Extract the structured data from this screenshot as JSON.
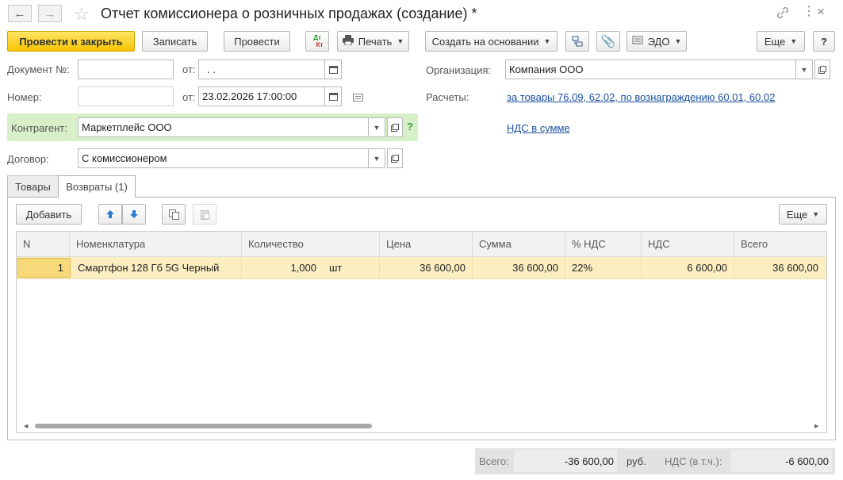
{
  "window": {
    "title": "Отчет комиссионера о розничных продажах (создание) *",
    "nav_back": "←",
    "nav_forward": "→"
  },
  "toolbar": {
    "post_close": "Провести и закрыть",
    "save": "Записать",
    "post": "Провести",
    "dtkt_top": "Дт",
    "dtkt_bottom": "Кт",
    "print": "Печать",
    "create_based": "Создать на основании",
    "edo": "ЭДО",
    "more": "Еще",
    "help": "?"
  },
  "form": {
    "doc_number_label": "Документ №:",
    "doc_number_value": "",
    "doc_from_label": "от:",
    "doc_date_value": " .  .",
    "number_label": "Номер:",
    "number_value": "",
    "number_from_label": "от:",
    "number_date_value": "23.02.2026 17:00:00",
    "org_label": "Организация:",
    "org_value": "Компания ООО",
    "calc_label": "Расчеты:",
    "calc_link": "за товары 76.09, 62.02, по вознаграждению 60.01, 60.02",
    "vat_link": "НДС в сумме",
    "counterparty_label": "Контрагент:",
    "counterparty_value": "Маркетплейс ООО",
    "counterparty_help": "?",
    "contract_label": "Договор:",
    "contract_value": "С комиссионером"
  },
  "tabs": [
    {
      "label": "Товары",
      "active": false
    },
    {
      "label": "Возвраты (1)",
      "active": true
    }
  ],
  "table_toolbar": {
    "add": "Добавить",
    "more": "Еще"
  },
  "table": {
    "headers": [
      "N",
      "Номенклатура",
      "Количество",
      "Цена",
      "Сумма",
      "% НДС",
      "НДС",
      "Всего"
    ],
    "rows": [
      {
        "n": "1",
        "item": "Смартфон 128 Гб 5G Черный",
        "qty": "1,000",
        "unit": "шт",
        "price": "36 600,00",
        "sum": "36 600,00",
        "vat_rate": "22%",
        "vat": "6 600,00",
        "total": "36 600,00"
      }
    ]
  },
  "footer": {
    "total_label": "Всего:",
    "total_value": "-36 600,00",
    "currency": "руб.",
    "vat_label": "НДС (в т.ч.):",
    "vat_value": "-6 600,00"
  },
  "colors": {
    "primary_button": "#f5c400",
    "counterparty_highlight": "#d8f0c8",
    "selected_row": "#fbefc2",
    "link": "#1b4fa0"
  }
}
